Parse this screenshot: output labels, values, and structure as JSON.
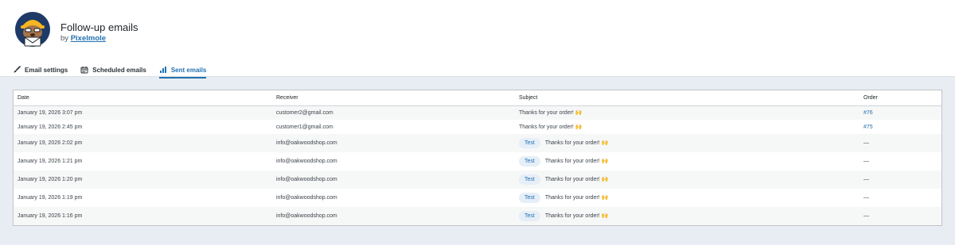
{
  "header": {
    "title": "Follow-up emails",
    "by_prefix": "by",
    "author": "Pixelmole"
  },
  "tabs": [
    {
      "label": "Email settings",
      "icon": "paintbrush-icon",
      "active": false
    },
    {
      "label": "Scheduled emails",
      "icon": "calendar-icon",
      "active": false
    },
    {
      "label": "Sent emails",
      "icon": "bar-chart-icon",
      "active": true
    }
  ],
  "table": {
    "columns": [
      "Date",
      "Receiver",
      "Subject",
      "Order"
    ],
    "rows": [
      {
        "date": "January 19, 2026 3:07 pm",
        "receiver": "customer2@gmail.com",
        "badge": "",
        "subject": "Thanks for your order! 🙌",
        "order": "#76"
      },
      {
        "date": "January 19, 2026 2:45 pm",
        "receiver": "customer1@gmail.com",
        "badge": "",
        "subject": "Thanks for your order! 🙌",
        "order": "#75"
      },
      {
        "date": "January 19, 2026 2:02 pm",
        "receiver": "info@oakwoodshop.com",
        "badge": "Test",
        "subject": "Thanks for your order! 🙌",
        "order": "—"
      },
      {
        "date": "January 19, 2026 1:21 pm",
        "receiver": "info@oakwoodshop.com",
        "badge": "Test",
        "subject": "Thanks for your order! 🙌",
        "order": "—"
      },
      {
        "date": "January 19, 2026 1:20 pm",
        "receiver": "info@oakwoodshop.com",
        "badge": "Test",
        "subject": "Thanks for your order! 🙌",
        "order": "—"
      },
      {
        "date": "January 19, 2026 1:19 pm",
        "receiver": "info@oakwoodshop.com",
        "badge": "Test",
        "subject": "Thanks for your order! 🙌",
        "order": "—"
      },
      {
        "date": "January 19, 2026 1:16 pm",
        "receiver": "info@oakwoodshop.com",
        "badge": "Test",
        "subject": "Thanks for your order! 🙌",
        "order": "—"
      }
    ]
  },
  "colors": {
    "accent": "#2271b1",
    "background": "#e8edf3",
    "badge_bg": "#e6eef8"
  }
}
